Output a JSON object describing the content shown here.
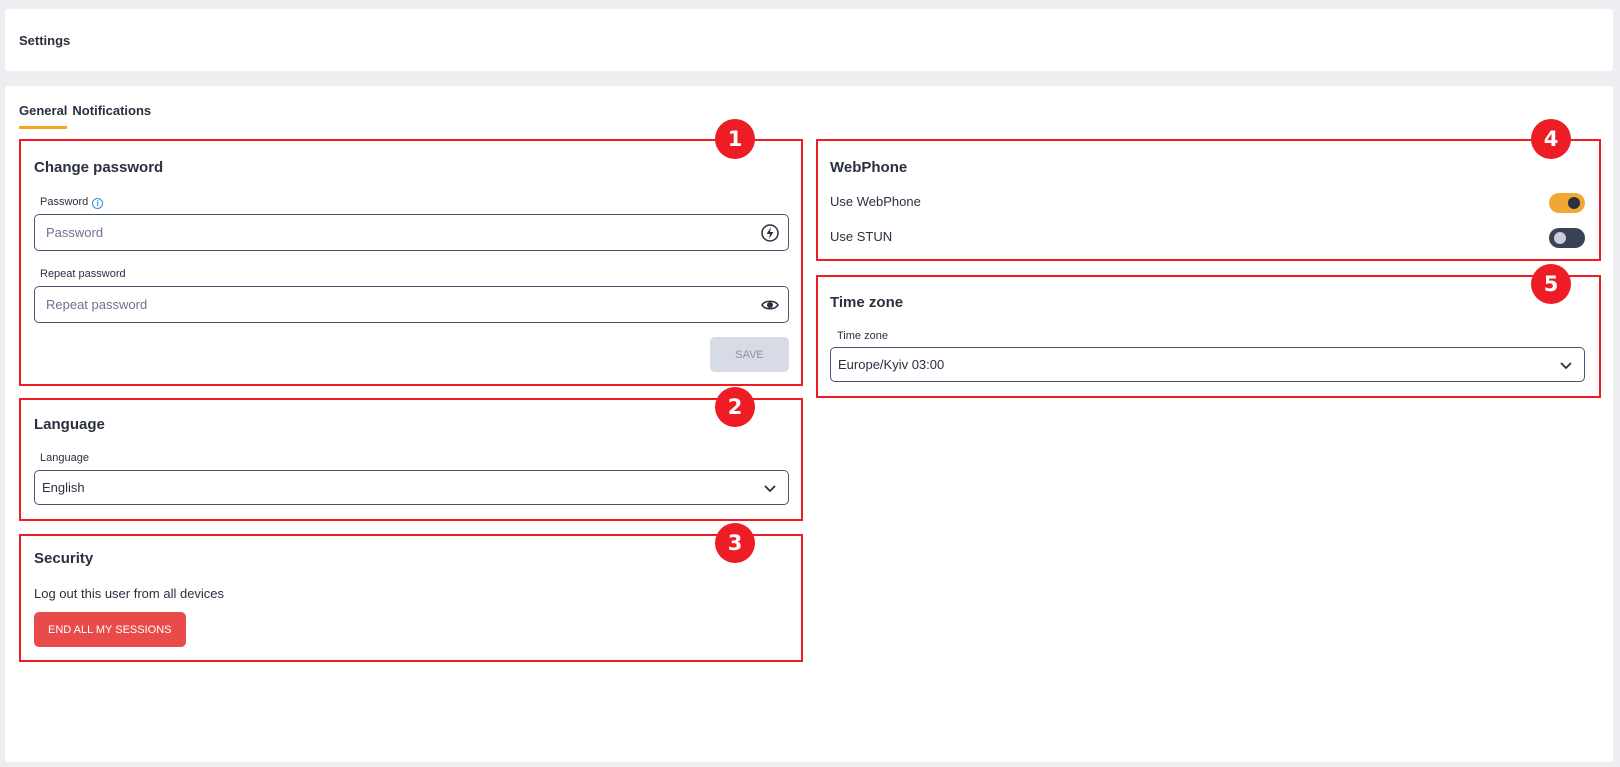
{
  "header": {
    "title": "Settings"
  },
  "tabs": [
    {
      "label": "General",
      "active": true
    },
    {
      "label": "Notifications",
      "active": false
    }
  ],
  "markers": [
    "1",
    "2",
    "3",
    "4",
    "5"
  ],
  "change_password": {
    "title": "Change password",
    "password_label": "Password",
    "password_placeholder": "Password",
    "password_icon": "lightning-bolt-icon",
    "repeat_label": "Repeat password",
    "repeat_placeholder": "Repeat password",
    "repeat_icon": "eye-icon",
    "save_label": "SAVE"
  },
  "language": {
    "title": "Language",
    "field_label": "Language",
    "value": "English"
  },
  "security": {
    "title": "Security",
    "description": "Log out this user from all devices",
    "button_label": "END ALL MY SESSIONS"
  },
  "webphone": {
    "title": "WebPhone",
    "use_webphone_label": "Use WebPhone",
    "use_webphone_on": true,
    "use_stun_label": "Use STUN",
    "use_stun_on": false
  },
  "timezone": {
    "title": "Time zone",
    "field_label": "Time zone",
    "value": "Europe/Kyiv 03:00"
  },
  "colors": {
    "annotation_red": "#ee1c25",
    "accent_orange": "#f5a623",
    "danger_button": "#e94b4b",
    "text_dark": "#2b3040"
  }
}
